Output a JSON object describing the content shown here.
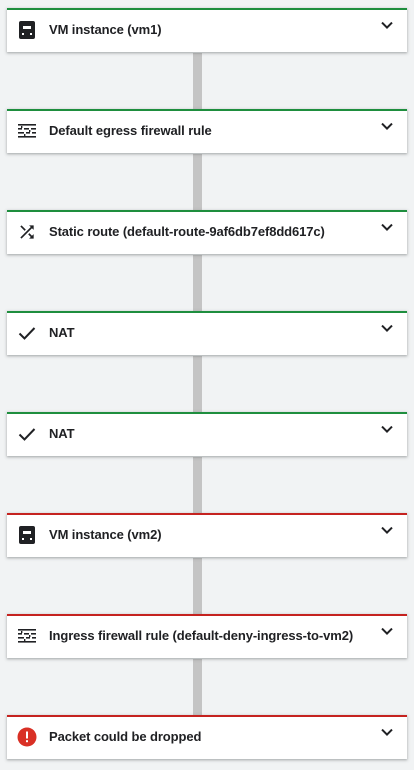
{
  "trace": {
    "steps": [
      {
        "label": "VM instance (vm1)",
        "icon": "vm-instance-icon",
        "status_color": "#1e8e3e"
      },
      {
        "label": "Default egress firewall rule",
        "icon": "firewall-rule-icon",
        "status_color": "#1e8e3e"
      },
      {
        "label": "Static route (default-route-9af6db7ef8dd617c)",
        "icon": "route-shuffle-icon",
        "status_color": "#1e8e3e"
      },
      {
        "label": "NAT",
        "icon": "checkmark-icon",
        "status_color": "#1e8e3e"
      },
      {
        "label": "NAT",
        "icon": "checkmark-icon",
        "status_color": "#1e8e3e"
      },
      {
        "label": "VM instance (vm2)",
        "icon": "vm-instance-icon",
        "status_color": "#c5221f"
      },
      {
        "label": "Ingress firewall rule (default-deny-ingress-to-vm2)",
        "icon": "firewall-rule-icon",
        "status_color": "#c5221f"
      },
      {
        "label": "Packet could be dropped",
        "icon": "error-icon",
        "status_color": "#c5221f"
      }
    ],
    "colors": {
      "card_background": "#ffffff",
      "page_background": "#f1f3f4",
      "connector": "#c4c4c4",
      "icon": "#202124",
      "error": "#d93025"
    }
  }
}
